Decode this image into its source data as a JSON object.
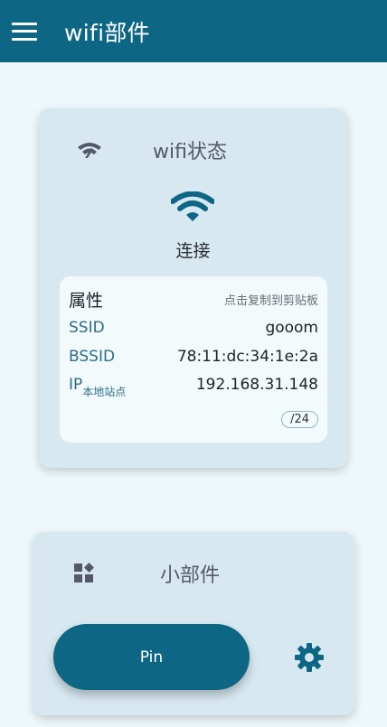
{
  "appbar": {
    "title": "wifi部件",
    "menu_icon": "menu-icon"
  },
  "wifi_card": {
    "title": "wifi状态",
    "header_icon": "wifi-signal-icon",
    "status_icon": "wifi-icon",
    "status": "连接",
    "properties": {
      "heading": "属性",
      "copy_hint": "点击复制到剪贴板",
      "ssid_label": "SSID",
      "ssid_value": "gooom",
      "bssid_label": "BSSID",
      "bssid_value": "78:11:dc:34:1e:2a",
      "ip_label": "IP",
      "ip_sub_label": "本地站点",
      "ip_value": "192.168.31.148",
      "prefix": "/24"
    }
  },
  "widget_card": {
    "title": "小部件",
    "header_icon": "widgets-icon",
    "pin_label": "Pin",
    "settings_icon": "gear-icon"
  },
  "colors": {
    "primary": "#0e6685",
    "card": "#d8e8f0",
    "background": "#eef8fb"
  }
}
